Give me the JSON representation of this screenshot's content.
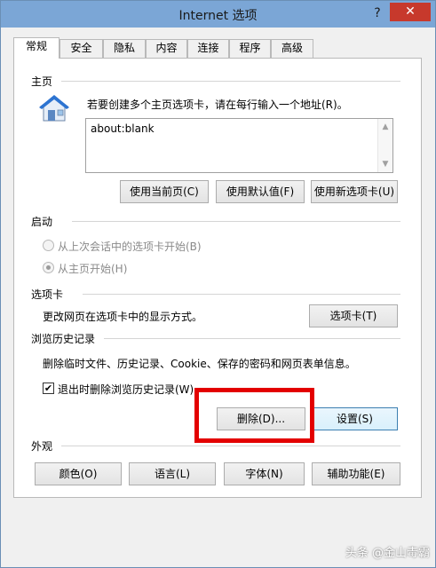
{
  "window": {
    "title": "Internet 选项",
    "help_glyph": "?",
    "close_glyph": "✕"
  },
  "tabs": [
    {
      "label": "常规",
      "active": true
    },
    {
      "label": "安全"
    },
    {
      "label": "隐私"
    },
    {
      "label": "内容"
    },
    {
      "label": "连接"
    },
    {
      "label": "程序"
    },
    {
      "label": "高级"
    }
  ],
  "homepage": {
    "title": "主页",
    "description": "若要创建多个主页选项卡，请在每行输入一个地址(R)。",
    "value": "about:blank",
    "buttons": [
      "使用当前页(C)",
      "使用默认值(F)",
      "使用新选项卡(U)"
    ]
  },
  "startup": {
    "title": "启动",
    "options": [
      {
        "label": "从上次会话中的选项卡开始(B)",
        "selected": false
      },
      {
        "label": "从主页开始(H)",
        "selected": true
      }
    ]
  },
  "tabs_section": {
    "title": "选项卡",
    "description": "更改网页在选项卡中的显示方式。",
    "button": "选项卡(T)"
  },
  "history": {
    "title": "浏览历史记录",
    "description": "删除临时文件、历史记录、Cookie、保存的密码和网页表单信息。",
    "checkbox_label": "退出时删除浏览历史记录(W)",
    "checkbox_checked": true,
    "check_glyph": "✔",
    "delete_button": "删除(D)...",
    "settings_button": "设置(S)"
  },
  "appearance": {
    "title": "外观",
    "buttons": [
      "颜色(O)",
      "语言(L)",
      "字体(N)",
      "辅助功能(E)"
    ]
  },
  "watermark": "头条 @金山毒霸"
}
